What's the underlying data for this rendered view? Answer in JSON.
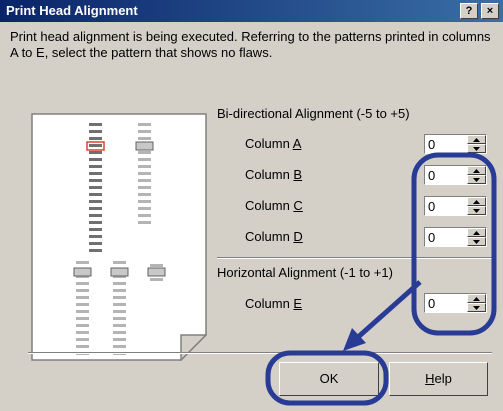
{
  "window": {
    "title": "Print Head Alignment",
    "help_button": "?",
    "close_button": "×"
  },
  "message": "Print head alignment is being executed. Referring to the patterns printed in columns A to E, select the pattern that shows no flaws.",
  "bidirectional": {
    "heading": "Bi-directional Alignment (-5 to +5)",
    "columns": [
      {
        "prefix": "Column ",
        "key": "A",
        "value": "0"
      },
      {
        "prefix": "Column ",
        "key": "B",
        "value": "0"
      },
      {
        "prefix": "Column ",
        "key": "C",
        "value": "0"
      },
      {
        "prefix": "Column ",
        "key": "D",
        "value": "0"
      }
    ]
  },
  "horizontal": {
    "heading": "Horizontal Alignment (-1 to +1)",
    "column": {
      "prefix": "Column ",
      "key": "E",
      "value": "0"
    }
  },
  "buttons": {
    "ok": "OK",
    "help_prefix": "",
    "help_key": "H",
    "help_rest": "elp"
  },
  "colors": {
    "highlight": "#283c96",
    "selected_pattern": "#e04030"
  }
}
